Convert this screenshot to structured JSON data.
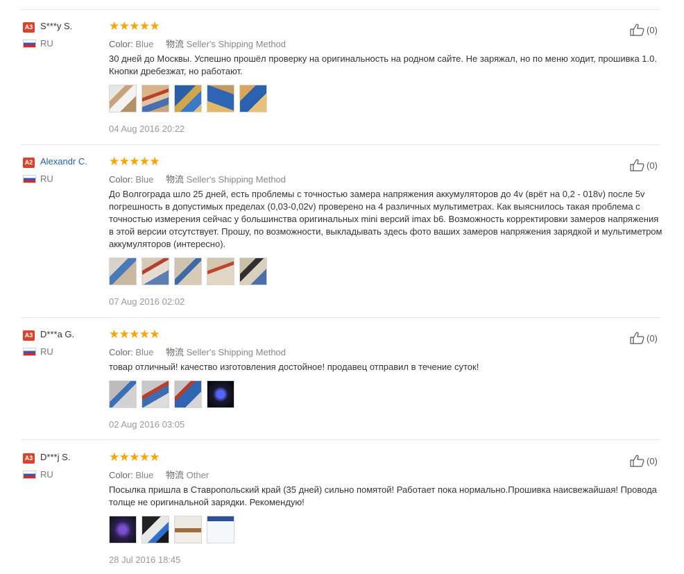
{
  "labels": {
    "color": "Color:",
    "shipping": "物流"
  },
  "reviews": [
    {
      "level": "A3",
      "name": "S***y S.",
      "country": "RU",
      "color": "Blue",
      "shipping": "Seller's Shipping Method",
      "text": "30 дней до Москвы. Успешно прошёл проверку на оригинальность на родном сайте. Не заряжал, но по меню ходит, прошивка 1.0. Кнопки дребезжат, но работают.",
      "date": "04 Aug 2016 20:22",
      "helpful": "(0)",
      "rating": 5
    },
    {
      "level": "A2",
      "name": "Alexandr C.",
      "country": "RU",
      "color": "Blue",
      "shipping": "Seller's Shipping Method",
      "text": "До Волгограда шло 25 дней, есть проблемы с точностью замера напряжения аккумуляторов до 4v (врёт на 0,2 - 018v) после 5v погрешность в допустимых пределах (0,03-0,02v) проверено на 4 различных мультиметрах. Как выяснилось такая проблема с точностью измерения сейчас у большинства оригинальных mini версий imax b6. Возможность корректировки замеров напряжения в этой версии отсутствует. Прошу, по возможности, выкладывать здесь фото ваших замеров напряжения зарядкой и мультиметром аккумуляторов (интересно).",
      "date": "07 Aug 2016 02:02",
      "helpful": "(0)",
      "rating": 5
    },
    {
      "level": "A3",
      "name": "D***a G.",
      "country": "RU",
      "color": "Blue",
      "shipping": "Seller's Shipping Method",
      "text": "товар отличный! качество изготовления достойное! продавец отправил в течение суток!",
      "date": "02 Aug 2016 03:05",
      "helpful": "(0)",
      "rating": 5
    },
    {
      "level": "A3",
      "name": "D***j S.",
      "country": "RU",
      "color": "Blue",
      "shipping": "Other",
      "text": "Посылка пришла в Ставропольский край (35 дней) сильно помятой! Работает пока нормально.Прошивка наисвежайшая! Провода толще не оригинальной зарядки. Рекомендую!",
      "date": "28 Jul 2016 18:45",
      "helpful": "(0)",
      "rating": 5
    }
  ],
  "colors": {
    "star": "#f7a500",
    "level_badge": "#d9432b",
    "link_name": "#1f5fa5"
  },
  "icons": {
    "helpful": "thumb-up-icon",
    "country": "russia-flag-icon",
    "rating": "star-icon"
  }
}
